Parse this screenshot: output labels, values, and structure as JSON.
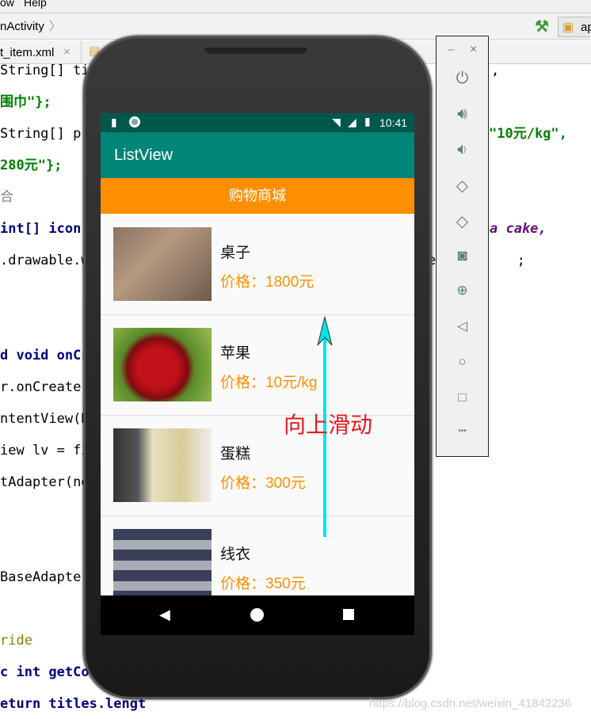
{
  "ide": {
    "menu": [
      "ow",
      "Help"
    ],
    "breadcrumb": "nActivity",
    "run_config": "ap",
    "tab": "t_item.xml",
    "tab_close": "×"
  },
  "code_left": [
    {
      "t": "String[] ti",
      "k": "plain"
    },
    {
      "t": "围巾\"};",
      "k": "str"
    },
    {
      "t": "String[] pr",
      "k": "plain"
    },
    {
      "t": "280元\"};",
      "k": "str"
    },
    {
      "t": "合",
      "k": "cmt"
    },
    {
      "t": "int[] icon",
      "k": "kw"
    },
    {
      "t": ".drawable.w",
      "k": "plain"
    },
    {
      "t": "d void onCr",
      "k": "kw"
    },
    {
      "t": "r.onCreate(",
      "k": "plain"
    },
    {
      "t": "ntentView(R",
      "k": "plain"
    },
    {
      "t": "iew lv = fi",
      "k": "plain"
    },
    {
      "t": "tAdapter(ne",
      "k": "plain"
    },
    {
      "t": "BaseAdapter",
      "k": "plain"
    },
    {
      "t": "ride",
      "k": "ann"
    },
    {
      "t": "c int getCo",
      "k": "kw"
    },
    {
      "t": "eturn titles.lengt",
      "k": "kw"
    }
  ],
  "code_right": [
    ",",
    "\"10元/kg\",",
    "a cake,",
    "e.         ;"
  ],
  "phone": {
    "time": "10:41",
    "app_title": "ListView",
    "header": "购物商城",
    "items": [
      {
        "name": "桌子",
        "price": "价格：1800元"
      },
      {
        "name": "苹果",
        "price": "价格：10元/kg"
      },
      {
        "name": "蛋糕",
        "price": "价格：300元"
      },
      {
        "name": "线衣",
        "price": "价格：350元"
      }
    ]
  },
  "annotation": {
    "text": "向上滑动",
    "color": "#e8191c",
    "arrow_color": "#00e5e5"
  },
  "panel": {
    "minimize": "–",
    "close": "×",
    "more": "•••"
  },
  "watermark": "https://blog.csdn.net/weixin_41842236"
}
